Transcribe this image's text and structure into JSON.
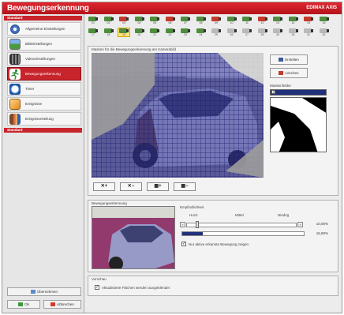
{
  "window": {
    "title": "Bewegungserkennung",
    "brand": "EDIMAX AXIS"
  },
  "sidebar": {
    "section_standard": "Standard",
    "section_standard2": "Standard",
    "items": [
      {
        "label": "Allgemeine Einstellungen",
        "icon": "gear-icon"
      },
      {
        "label": "Bildeinstellungen",
        "icon": "image-icon"
      },
      {
        "label": "Videoeinstellungen",
        "icon": "film-icon"
      },
      {
        "label": "Bewegungserkennung",
        "icon": "running-man-icon"
      },
      {
        "label": "Timer",
        "icon": "clock-icon"
      },
      {
        "label": "Ereignisse",
        "icon": "cube-icon"
      },
      {
        "label": "Ereignisverteilung",
        "icon": "book-icon"
      }
    ],
    "apply_label": "Übernehmen",
    "ok_label": "Ok",
    "cancel_label": "Abbrechen"
  },
  "cameras": {
    "row1": [
      "01",
      "02",
      "03",
      "04",
      "05",
      "06",
      "07",
      "08",
      "09",
      "10",
      "11",
      "12",
      "13",
      "14",
      "15",
      "16"
    ],
    "row2": [
      "17",
      "18",
      "19",
      "20",
      "21",
      "22",
      "23",
      "24",
      "25",
      "26",
      "27",
      "28",
      "29",
      "30",
      "31",
      "32"
    ]
  },
  "motion_area": {
    "title": "Masken für die Bewegungserkennung am Kamerabild",
    "tools": [
      "✕+",
      "✕−",
      "▦+",
      "▦−"
    ],
    "create_label": "Erstellen",
    "delete_label": "Löschen",
    "mask_label": "Maskenfelder"
  },
  "detection": {
    "title": "Bewegungserkennung",
    "sensitivity_title": "Empfindlichkeit",
    "scale": [
      "Hoch",
      "Mittel",
      "Niedrig"
    ],
    "sensitivity_value": "10,00%",
    "level_value": "16,60%",
    "sensitivity_fraction": 0.1,
    "level_fraction": 0.166,
    "show_motion_label": "Nur aktive erkannte Bewegung zeigen",
    "show_motion_checked": true
  },
  "preview": {
    "title": "Vorschau",
    "check_label": "Aktualisierte Flächen werden ausgeblendet",
    "checked": true
  },
  "colors": {
    "accent": "#c8242c",
    "mask_blue": "#2e2f9e",
    "level_bar": "#20307a"
  }
}
